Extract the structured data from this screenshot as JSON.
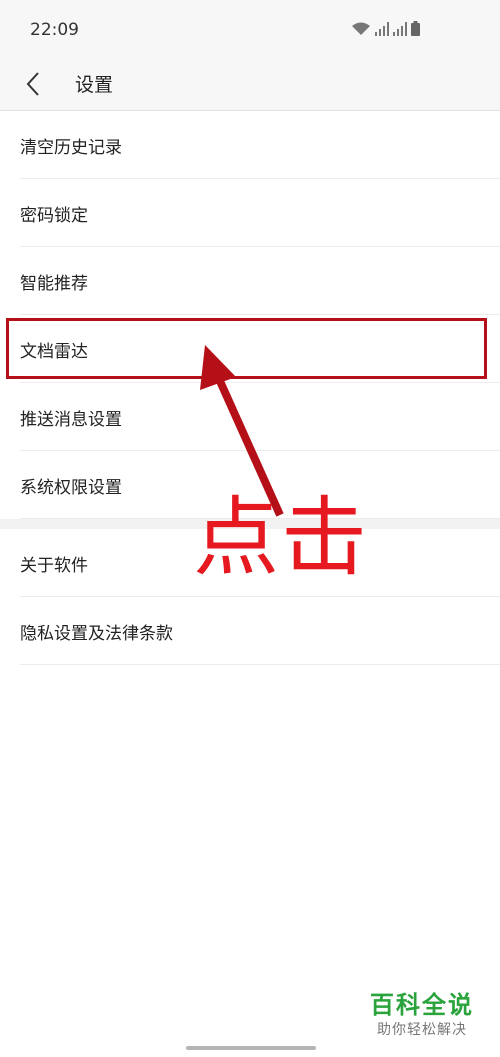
{
  "status_bar": {
    "time": "22:09"
  },
  "header": {
    "title": "设置"
  },
  "groups": [
    {
      "items": [
        "清空历史记录",
        "密码锁定",
        "智能推荐",
        "文档雷达",
        "推送消息设置",
        "系统权限设置"
      ]
    },
    {
      "items": [
        "关于软件",
        "隐私设置及法律条款"
      ]
    }
  ],
  "annotation": {
    "text": "点击",
    "color": "#e5191f",
    "box_color": "#b50f17"
  },
  "watermark": {
    "title": "百科全说",
    "subtitle": "助你轻松解决"
  },
  "colors": {
    "background": "#ffffff",
    "bar": "#f7f7f7",
    "divider": "#ececec",
    "watermark_green": "#2aa33c"
  }
}
